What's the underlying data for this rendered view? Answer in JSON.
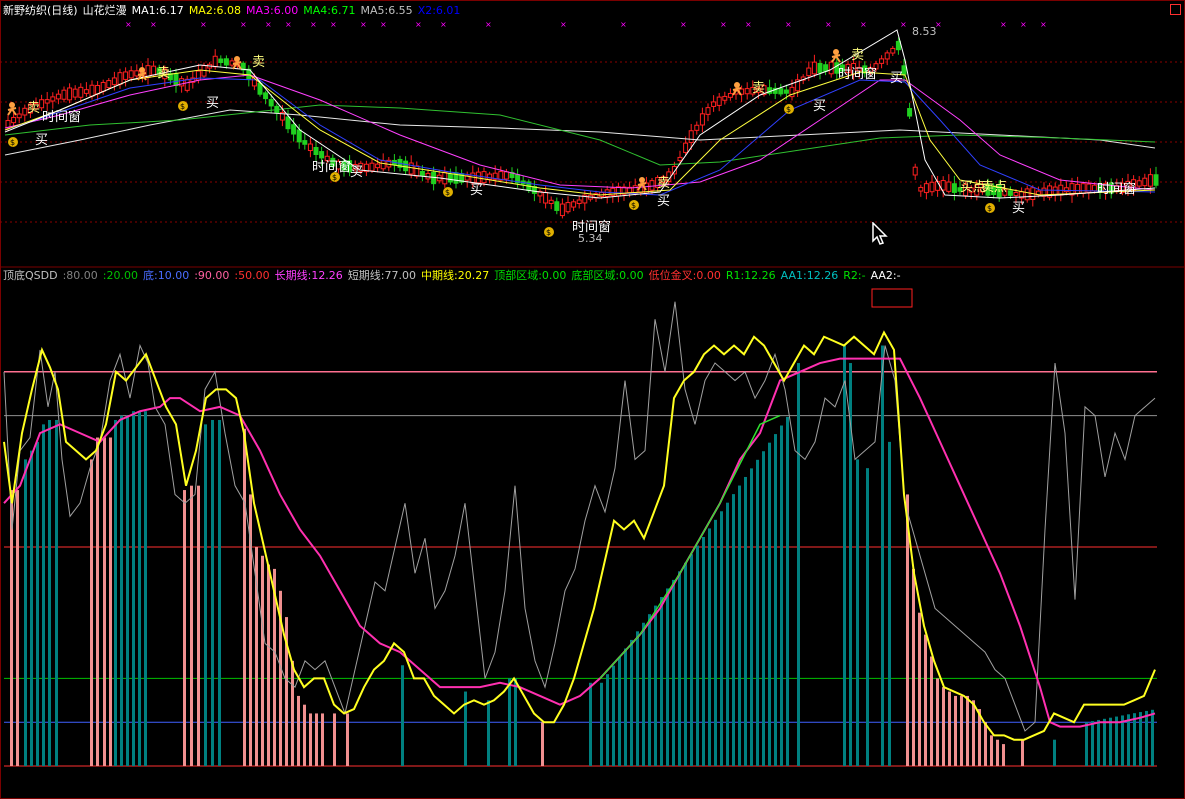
{
  "top_legend": [
    {
      "text": "新野纺织(日线)",
      "color": "#ffffff"
    },
    {
      "text": "山花烂漫",
      "color": "#ffffff"
    },
    {
      "text": "MA1:6.17",
      "color": "#ffffff"
    },
    {
      "text": "MA2:6.08",
      "color": "#ffff00"
    },
    {
      "text": "MA3:6.00",
      "color": "#ff00ff"
    },
    {
      "text": "MA4:6.71",
      "color": "#00ff00"
    },
    {
      "text": "MA5:6.55",
      "color": "#c0c0c0"
    },
    {
      "text": "X2:6.01",
      "color": "#0000ff"
    }
  ],
  "bottom_legend": [
    {
      "text": "顶底QSDD",
      "color": "#c0c0c0"
    },
    {
      "text": ":80.00",
      "color": "#808080"
    },
    {
      "text": ":20.00",
      "color": "#00c000"
    },
    {
      "text": "底:10.00",
      "color": "#4a6cff"
    },
    {
      "text": ":90.00",
      "color": "#ff60a0"
    },
    {
      "text": ":50.00",
      "color": "#ff3030"
    },
    {
      "text": "长期线:12.26",
      "color": "#ff40ff"
    },
    {
      "text": "短期线:77.00",
      "color": "#c0c0c0"
    },
    {
      "text": "中期线:20.27",
      "color": "#ffff00"
    },
    {
      "text": "顶部区域:0.00",
      "color": "#00e000"
    },
    {
      "text": "底部区域:0.00",
      "color": "#00e000"
    },
    {
      "text": "低位金叉:0.00",
      "color": "#ff3030"
    },
    {
      "text": "R1:12.26",
      "color": "#00e000"
    },
    {
      "text": "AA1:12.26",
      "color": "#00c0c0"
    },
    {
      "text": "R2:-",
      "color": "#00e000"
    },
    {
      "text": "AA2:-",
      "color": "#ffffff"
    }
  ],
  "signals": {
    "sell": "卖",
    "buy": "买",
    "time_window": "时间窗",
    "buy_point": "买点",
    "sell_point": "卖点"
  },
  "chart_data": [
    {
      "type": "line",
      "title": "新野纺织(日线) 山花烂漫",
      "series": [
        {
          "name": "MA1"
        },
        {
          "name": "MA2"
        },
        {
          "name": "MA3"
        },
        {
          "name": "MA4"
        },
        {
          "name": "MA5"
        },
        {
          "name": "X2"
        }
      ],
      "price_high": 8.53,
      "price_low": 5.34,
      "price_labels": [
        "8.53",
        "5.34"
      ]
    },
    {
      "type": "line",
      "title": "顶底QSDD",
      "ylim": [
        0,
        100
      ],
      "levels": [
        80,
        20,
        10,
        90,
        50
      ],
      "series": [
        {
          "name": "长期线",
          "last": 12.26
        },
        {
          "name": "短期线",
          "last": 77.0
        },
        {
          "name": "中期线",
          "last": 20.27
        }
      ]
    }
  ]
}
